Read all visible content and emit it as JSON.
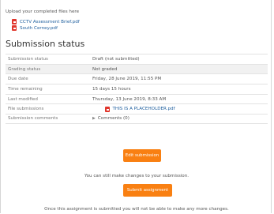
{
  "upload": {
    "label": "Upload your completed files here",
    "files": [
      {
        "name": "CCTV Assessment Brief.pdf",
        "icon": "pdf-icon"
      },
      {
        "name": "South Cerney.pdf",
        "icon": "pdf-icon"
      }
    ]
  },
  "submission": {
    "title": "Submission status",
    "rows": [
      {
        "label": "Submission status",
        "value": "Draft (not submitted)"
      },
      {
        "label": "Grading status",
        "value": "Not graded"
      },
      {
        "label": "Due date",
        "value": "Friday, 28 June 2019, 11:55 PM"
      },
      {
        "label": "Time remaining",
        "value": "15 days 15 hours"
      },
      {
        "label": "Last modified",
        "value": "Thursday, 13 June 2019, 8:33 AM"
      },
      {
        "label": "File submissions",
        "value": "THIS IS A PLACEHOLDER.pdf"
      },
      {
        "label": "Submission comments",
        "value": "Comments (0)"
      }
    ]
  },
  "actions": {
    "edit_label": "Edit submission",
    "edit_hint": "You can still make changes to your submission.",
    "submit_label": "Submit assignment",
    "submit_hint": "Once this assignment is submitted you will not be able to make any more changes."
  },
  "colors": {
    "accent": "#f98012",
    "link": "#1f5f9e",
    "pdf": "#e0352b"
  }
}
